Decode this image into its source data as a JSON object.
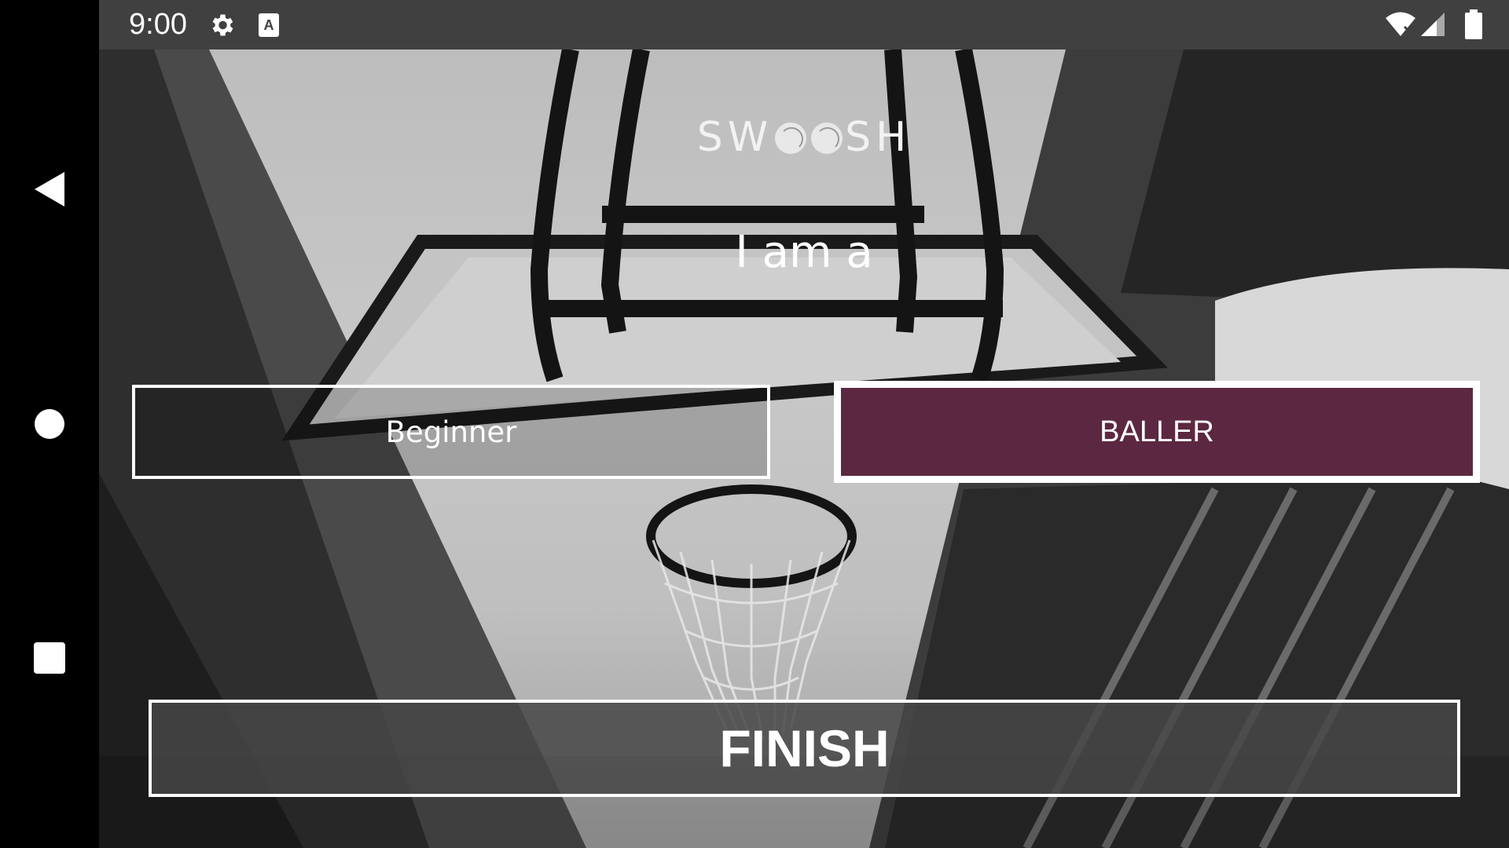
{
  "status_bar": {
    "time": "9:00",
    "icons": [
      "gear-icon",
      "keyboard-a-icon",
      "wifi-icon",
      "signal-icon",
      "battery-icon"
    ]
  },
  "nav_bar": {
    "buttons": [
      "back-icon",
      "home-icon",
      "recents-icon"
    ]
  },
  "app": {
    "logo": {
      "text_before": "SW",
      "text_after": "SH"
    },
    "prompt": "I am a",
    "choices": {
      "beginner": "Beginner",
      "baller": "BALLER"
    },
    "selected_choice": "BALLER",
    "finish_label": "FINISH",
    "accent_color": "#5c2841"
  }
}
